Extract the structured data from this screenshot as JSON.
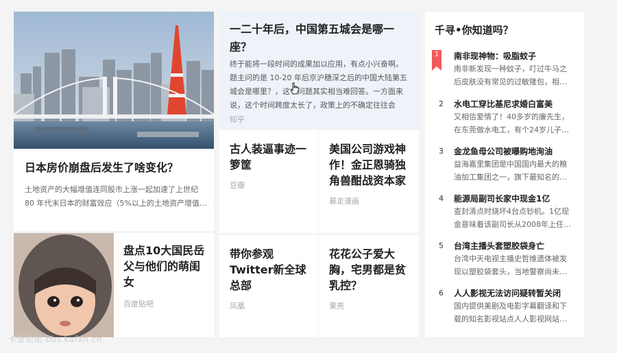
{
  "cards": {
    "japan": {
      "title": "日本房价崩盘后发生了啥变化？",
      "desc": "土地资产的大幅增值连同股市上涨一起加速了上世纪 80 年代末日本的财富效应（5%以上的土地资产增值…"
    },
    "baby": {
      "title": "盘点10大国民岳父与他们的萌闺女",
      "source": "百度贴吧"
    },
    "city": {
      "title": "一二十年后，中国第五城会是哪一座？",
      "desc": "终于能将一段时间的成果加以应用，有点小兴奋啊。题主问的是 10-20 年后京沪穗深之后的中国大陆第五城会是哪里？，这个问题其实相当难回答。一方面来说，这个时间跨度太长了，政策上的不确定往往会造…",
      "source": "知乎"
    },
    "ancient": {
      "title": "古人装逼事迹一箩筐",
      "source": "豆瓣"
    },
    "usa": {
      "title": "美国公司游戏神作！金正恩骑独角兽酣战资本家",
      "source": "暴走漫画"
    },
    "twitter": {
      "title": "带你参观Twitter新全球总部",
      "source": "凤凰"
    },
    "playboy": {
      "title": "花花公子爱大胸，宅男都是贫乳控？",
      "source": "果壳"
    }
  },
  "sidebar": {
    "heading": "千寻•你知道吗？",
    "accent_color": "#f25b5b",
    "items": [
      {
        "rank": "1",
        "title": "南非现神物：吸脂蚊子",
        "desc": "南非新发现一种蚊子，叮过牛马之后皮肤没有常见的过敏隆包，相…"
      },
      {
        "rank": "2",
        "title": "水电工穿比基尼求婚白富美",
        "desc": "又相信爱情了！40多岁的廉先生，在东莞做水电工，有个24岁儿子…"
      },
      {
        "rank": "3",
        "title": "金龙鱼母公司被曝购地洵油",
        "desc": "益海嘉里集团是中国国内最大的粮油加工集团之一，旗下最知名的…"
      },
      {
        "rank": "4",
        "title": "能源局副司长家中现金1亿",
        "desc": "查封清点时烧坏4台点钞机。1亿现金意味着该副司长从2008年上任…"
      },
      {
        "rank": "5",
        "title": "台湾主播头套塑胶袋身亡",
        "desc": "台湾中天电视主播史哲维遗体被发现以塑胶袋套头，当地警察尚未…"
      },
      {
        "rank": "6",
        "title": "人人影视无法访问疑转暂关闭",
        "desc": "国内提供美剧及电影字幕翻译和下载的知名影视站点人人影视网站…"
      }
    ]
  },
  "watermark": "卡饭论坛 bbs.kafan.cn"
}
